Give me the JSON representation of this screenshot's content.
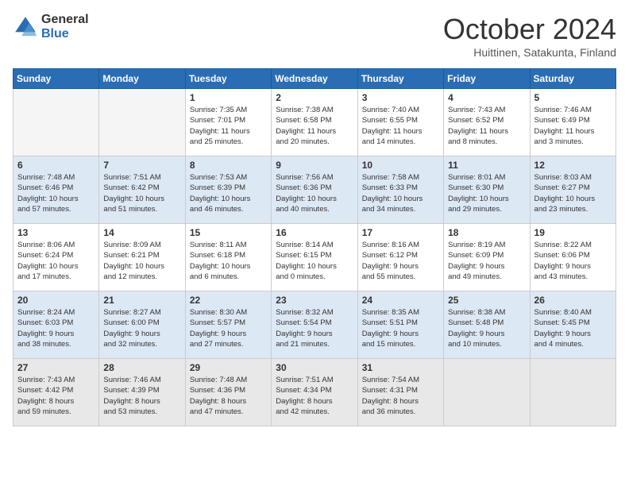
{
  "header": {
    "logo": {
      "general": "General",
      "blue": "Blue"
    },
    "title": "October 2024",
    "location": "Huittinen, Satakunta, Finland"
  },
  "calendar": {
    "days": [
      "Sunday",
      "Monday",
      "Tuesday",
      "Wednesday",
      "Thursday",
      "Friday",
      "Saturday"
    ],
    "weeks": [
      [
        {
          "day": "",
          "info": ""
        },
        {
          "day": "",
          "info": ""
        },
        {
          "day": "1",
          "info": "Sunrise: 7:35 AM\nSunset: 7:01 PM\nDaylight: 11 hours\nand 25 minutes."
        },
        {
          "day": "2",
          "info": "Sunrise: 7:38 AM\nSunset: 6:58 PM\nDaylight: 11 hours\nand 20 minutes."
        },
        {
          "day": "3",
          "info": "Sunrise: 7:40 AM\nSunset: 6:55 PM\nDaylight: 11 hours\nand 14 minutes."
        },
        {
          "day": "4",
          "info": "Sunrise: 7:43 AM\nSunset: 6:52 PM\nDaylight: 11 hours\nand 8 minutes."
        },
        {
          "day": "5",
          "info": "Sunrise: 7:46 AM\nSunset: 6:49 PM\nDaylight: 11 hours\nand 3 minutes."
        }
      ],
      [
        {
          "day": "6",
          "info": "Sunrise: 7:48 AM\nSunset: 6:46 PM\nDaylight: 10 hours\nand 57 minutes."
        },
        {
          "day": "7",
          "info": "Sunrise: 7:51 AM\nSunset: 6:42 PM\nDaylight: 10 hours\nand 51 minutes."
        },
        {
          "day": "8",
          "info": "Sunrise: 7:53 AM\nSunset: 6:39 PM\nDaylight: 10 hours\nand 46 minutes."
        },
        {
          "day": "9",
          "info": "Sunrise: 7:56 AM\nSunset: 6:36 PM\nDaylight: 10 hours\nand 40 minutes."
        },
        {
          "day": "10",
          "info": "Sunrise: 7:58 AM\nSunset: 6:33 PM\nDaylight: 10 hours\nand 34 minutes."
        },
        {
          "day": "11",
          "info": "Sunrise: 8:01 AM\nSunset: 6:30 PM\nDaylight: 10 hours\nand 29 minutes."
        },
        {
          "day": "12",
          "info": "Sunrise: 8:03 AM\nSunset: 6:27 PM\nDaylight: 10 hours\nand 23 minutes."
        }
      ],
      [
        {
          "day": "13",
          "info": "Sunrise: 8:06 AM\nSunset: 6:24 PM\nDaylight: 10 hours\nand 17 minutes."
        },
        {
          "day": "14",
          "info": "Sunrise: 8:09 AM\nSunset: 6:21 PM\nDaylight: 10 hours\nand 12 minutes."
        },
        {
          "day": "15",
          "info": "Sunrise: 8:11 AM\nSunset: 6:18 PM\nDaylight: 10 hours\nand 6 minutes."
        },
        {
          "day": "16",
          "info": "Sunrise: 8:14 AM\nSunset: 6:15 PM\nDaylight: 10 hours\nand 0 minutes."
        },
        {
          "day": "17",
          "info": "Sunrise: 8:16 AM\nSunset: 6:12 PM\nDaylight: 9 hours\nand 55 minutes."
        },
        {
          "day": "18",
          "info": "Sunrise: 8:19 AM\nSunset: 6:09 PM\nDaylight: 9 hours\nand 49 minutes."
        },
        {
          "day": "19",
          "info": "Sunrise: 8:22 AM\nSunset: 6:06 PM\nDaylight: 9 hours\nand 43 minutes."
        }
      ],
      [
        {
          "day": "20",
          "info": "Sunrise: 8:24 AM\nSunset: 6:03 PM\nDaylight: 9 hours\nand 38 minutes."
        },
        {
          "day": "21",
          "info": "Sunrise: 8:27 AM\nSunset: 6:00 PM\nDaylight: 9 hours\nand 32 minutes."
        },
        {
          "day": "22",
          "info": "Sunrise: 8:30 AM\nSunset: 5:57 PM\nDaylight: 9 hours\nand 27 minutes."
        },
        {
          "day": "23",
          "info": "Sunrise: 8:32 AM\nSunset: 5:54 PM\nDaylight: 9 hours\nand 21 minutes."
        },
        {
          "day": "24",
          "info": "Sunrise: 8:35 AM\nSunset: 5:51 PM\nDaylight: 9 hours\nand 15 minutes."
        },
        {
          "day": "25",
          "info": "Sunrise: 8:38 AM\nSunset: 5:48 PM\nDaylight: 9 hours\nand 10 minutes."
        },
        {
          "day": "26",
          "info": "Sunrise: 8:40 AM\nSunset: 5:45 PM\nDaylight: 9 hours\nand 4 minutes."
        }
      ],
      [
        {
          "day": "27",
          "info": "Sunrise: 7:43 AM\nSunset: 4:42 PM\nDaylight: 8 hours\nand 59 minutes."
        },
        {
          "day": "28",
          "info": "Sunrise: 7:46 AM\nSunset: 4:39 PM\nDaylight: 8 hours\nand 53 minutes."
        },
        {
          "day": "29",
          "info": "Sunrise: 7:48 AM\nSunset: 4:36 PM\nDaylight: 8 hours\nand 47 minutes."
        },
        {
          "day": "30",
          "info": "Sunrise: 7:51 AM\nSunset: 4:34 PM\nDaylight: 8 hours\nand 42 minutes."
        },
        {
          "day": "31",
          "info": "Sunrise: 7:54 AM\nSunset: 4:31 PM\nDaylight: 8 hours\nand 36 minutes."
        },
        {
          "day": "",
          "info": ""
        },
        {
          "day": "",
          "info": ""
        }
      ]
    ]
  }
}
